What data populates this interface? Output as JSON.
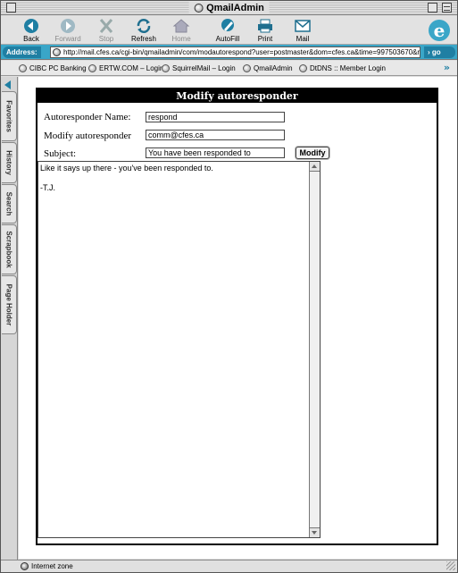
{
  "window": {
    "title": "QmailAdmin"
  },
  "toolbar": {
    "back": "Back",
    "forward": "Forward",
    "stop": "Stop",
    "refresh": "Refresh",
    "home": "Home",
    "autofill": "AutoFill",
    "print": "Print",
    "mail": "Mail"
  },
  "address": {
    "label": "Address:",
    "url": "http://mail.cfes.ca/cgi-bin/qmailadmin/com/modautorespond?user=postmaster&dom=cfes.ca&time=997503670&r",
    "go": "go"
  },
  "favorites": [
    {
      "label": "CIBC PC Banking"
    },
    {
      "label": "ERTW.COM – Login"
    },
    {
      "label": "SquirrelMail – Login"
    },
    {
      "label": "QmailAdmin"
    },
    {
      "label": "DtDNS :: Member Login"
    }
  ],
  "sidebar": {
    "tabs": [
      "Favorites",
      "History",
      "Search",
      "Scrapbook",
      "Page Holder"
    ]
  },
  "form": {
    "heading": "Modify autoresponder",
    "name_label": "Autoresponder Name:",
    "name_value": "respond",
    "modify_label": "Modify autoresponder",
    "modify_value": "comm@cfes.ca",
    "subject_label": "Subject:",
    "subject_value": "You have been responded to",
    "modify_button": "Modify",
    "message_line1": "Like it says up there - you've been responded to.",
    "message_line2": "-T.J."
  },
  "status": {
    "text": "Internet zone"
  },
  "colors": {
    "accent": "#3aa6c8",
    "accent_dark": "#1f7fa3"
  }
}
